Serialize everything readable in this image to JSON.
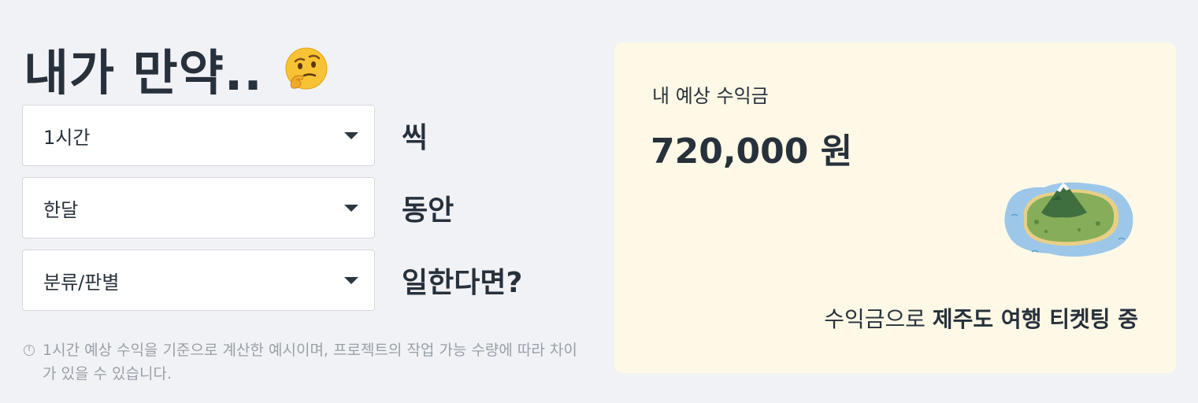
{
  "headline": {
    "title": "내가 만약..",
    "emoji_icon": "thinking-face-icon"
  },
  "selectors": [
    {
      "value": "1시간",
      "suffix": "씩"
    },
    {
      "value": "한달",
      "suffix": "동안"
    },
    {
      "value": "분류/판별",
      "suffix": "일한다면?"
    }
  ],
  "note": {
    "icon": "info-icon",
    "text": "1시간 예상 수익을 기준으로 계산한 예시이며, 프로젝트의 작업 가능 수량에 따라 차이가 있을 수 있습니다."
  },
  "result": {
    "label": "내 예상 수익금",
    "amount": "720,000 원",
    "illustration": "island-icon",
    "caption_prefix": "수익금으로 ",
    "caption_highlight": "제주도 여행 티켓팅 중"
  },
  "colors": {
    "background": "#f1f2f6",
    "card": "#fef8e6",
    "text": "#27313c",
    "muted": "#9aa0a8"
  }
}
